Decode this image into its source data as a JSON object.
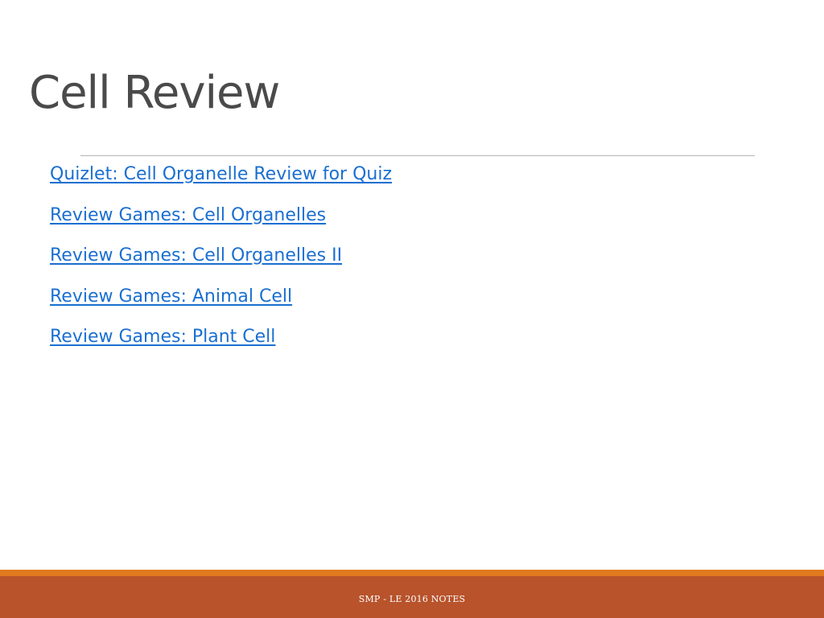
{
  "slide": {
    "title": "Cell Review",
    "links": [
      {
        "label": "Quizlet: Cell Organelle Review for Quiz"
      },
      {
        "label": "Review Games: Cell Organelles"
      },
      {
        "label": "Review Games: Cell Organelles II"
      },
      {
        "label": "Review Games: Animal Cell"
      },
      {
        "label": "Review Games: Plant Cell"
      }
    ],
    "footer": "SMP - LE 2016 NOTES"
  },
  "colors": {
    "title_text": "#4a4a4a",
    "link": "#1a6fd1",
    "footer_accent": "#e1791f",
    "footer_band": "#b8532c",
    "footer_text": "#ffffff",
    "divider": "#b4b4b4"
  }
}
